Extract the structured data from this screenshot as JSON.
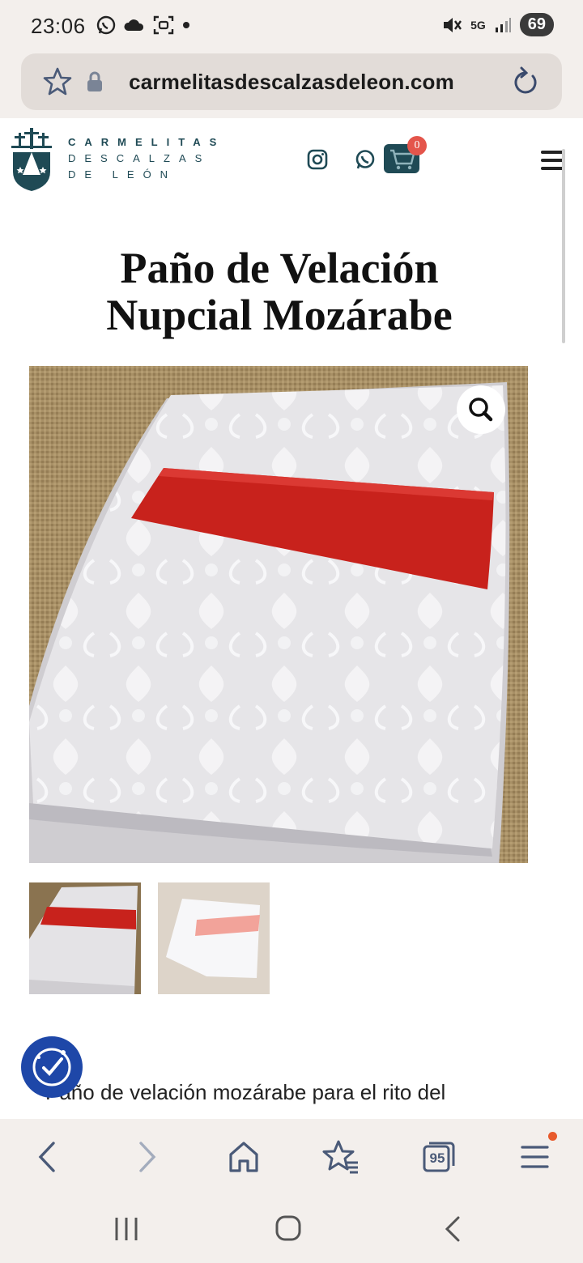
{
  "status_bar": {
    "time": "23:06",
    "signal": "5G",
    "battery": "69"
  },
  "url_bar": {
    "url": "carmelitasdescalzasdeleon.com"
  },
  "header": {
    "brand_line1": "CARMELITAS",
    "brand_line2": "DESCALZAS",
    "brand_line3": "DE LEÓN",
    "cart_count": "0"
  },
  "product": {
    "title": "Paño de Velación Nupcial Mozárabe",
    "description_start": "Paño de velación  mozárabe para el rito del",
    "colors": {
      "band_red": "#c8221c",
      "band_pink": "#f2a39a",
      "cloth": "#e9e8ea",
      "burlap": "#a89066"
    }
  },
  "browser_nav": {
    "tabs_count": "95"
  },
  "icons": {
    "url_bar": [
      "star-icon",
      "lock-icon",
      "reload-icon"
    ],
    "header": [
      "instagram-icon",
      "whatsapp-icon",
      "cart-icon",
      "hamburger-menu-icon"
    ],
    "browser_nav": [
      "back-icon",
      "forward-icon",
      "home-icon",
      "bookmarks-icon",
      "tabs-icon",
      "menu-icon"
    ],
    "system_nav": [
      "recents-icon",
      "home-circle-icon",
      "system-back-icon"
    ]
  }
}
